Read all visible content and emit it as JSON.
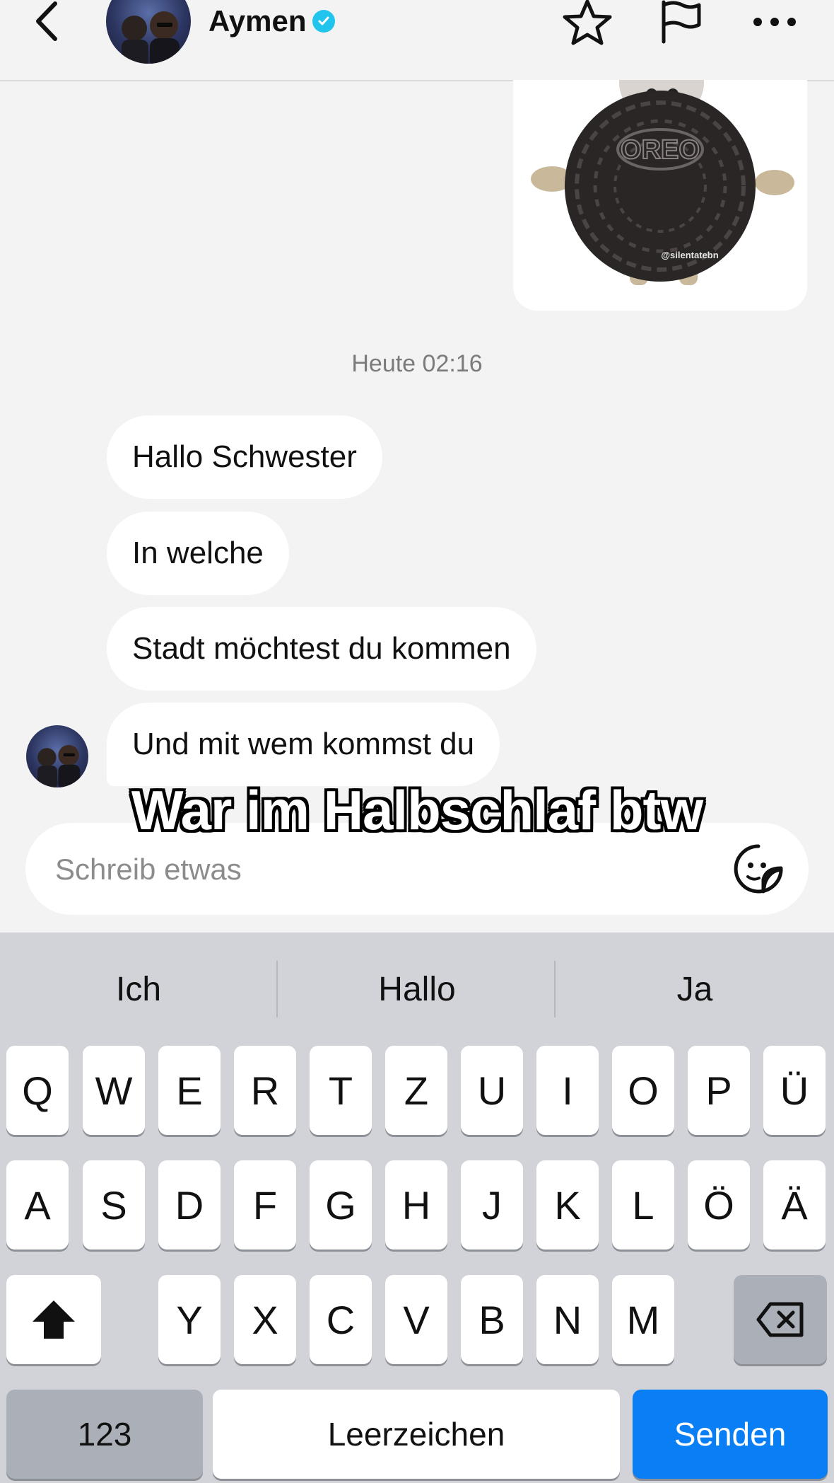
{
  "header": {
    "contact_name": "Aymen",
    "verified": true,
    "icons": [
      "back-icon",
      "star-icon",
      "flag-icon",
      "more-icon"
    ]
  },
  "chat": {
    "image_watermark": "@silentatebn",
    "image_brand": "OREO",
    "timestamp": "Heute 02:16",
    "messages": [
      "Hallo Schwester",
      "In welche",
      "Stadt möchtest du kommen",
      "Und mit wem kommst du"
    ],
    "overlay_caption": "War im Halbschlaf btw"
  },
  "input": {
    "placeholder": "Schreib etwas",
    "value": ""
  },
  "keyboard": {
    "suggestions": [
      "Ich",
      "Hallo",
      "Ja"
    ],
    "row1": [
      "Q",
      "W",
      "E",
      "R",
      "T",
      "Z",
      "U",
      "I",
      "O",
      "P",
      "Ü"
    ],
    "row2": [
      "A",
      "S",
      "D",
      "F",
      "G",
      "H",
      "J",
      "K",
      "L",
      "Ö",
      "Ä"
    ],
    "row3": [
      "Y",
      "X",
      "C",
      "V",
      "B",
      "N",
      "M"
    ],
    "numbers_label": "123",
    "space_label": "Leerzeichen",
    "send_label": "Senden"
  },
  "colors": {
    "background": "#f3f3f4",
    "verified_badge": "#20c4ec",
    "send_key": "#0a7ff5",
    "keyboard_bg": "#d1d3d9"
  }
}
